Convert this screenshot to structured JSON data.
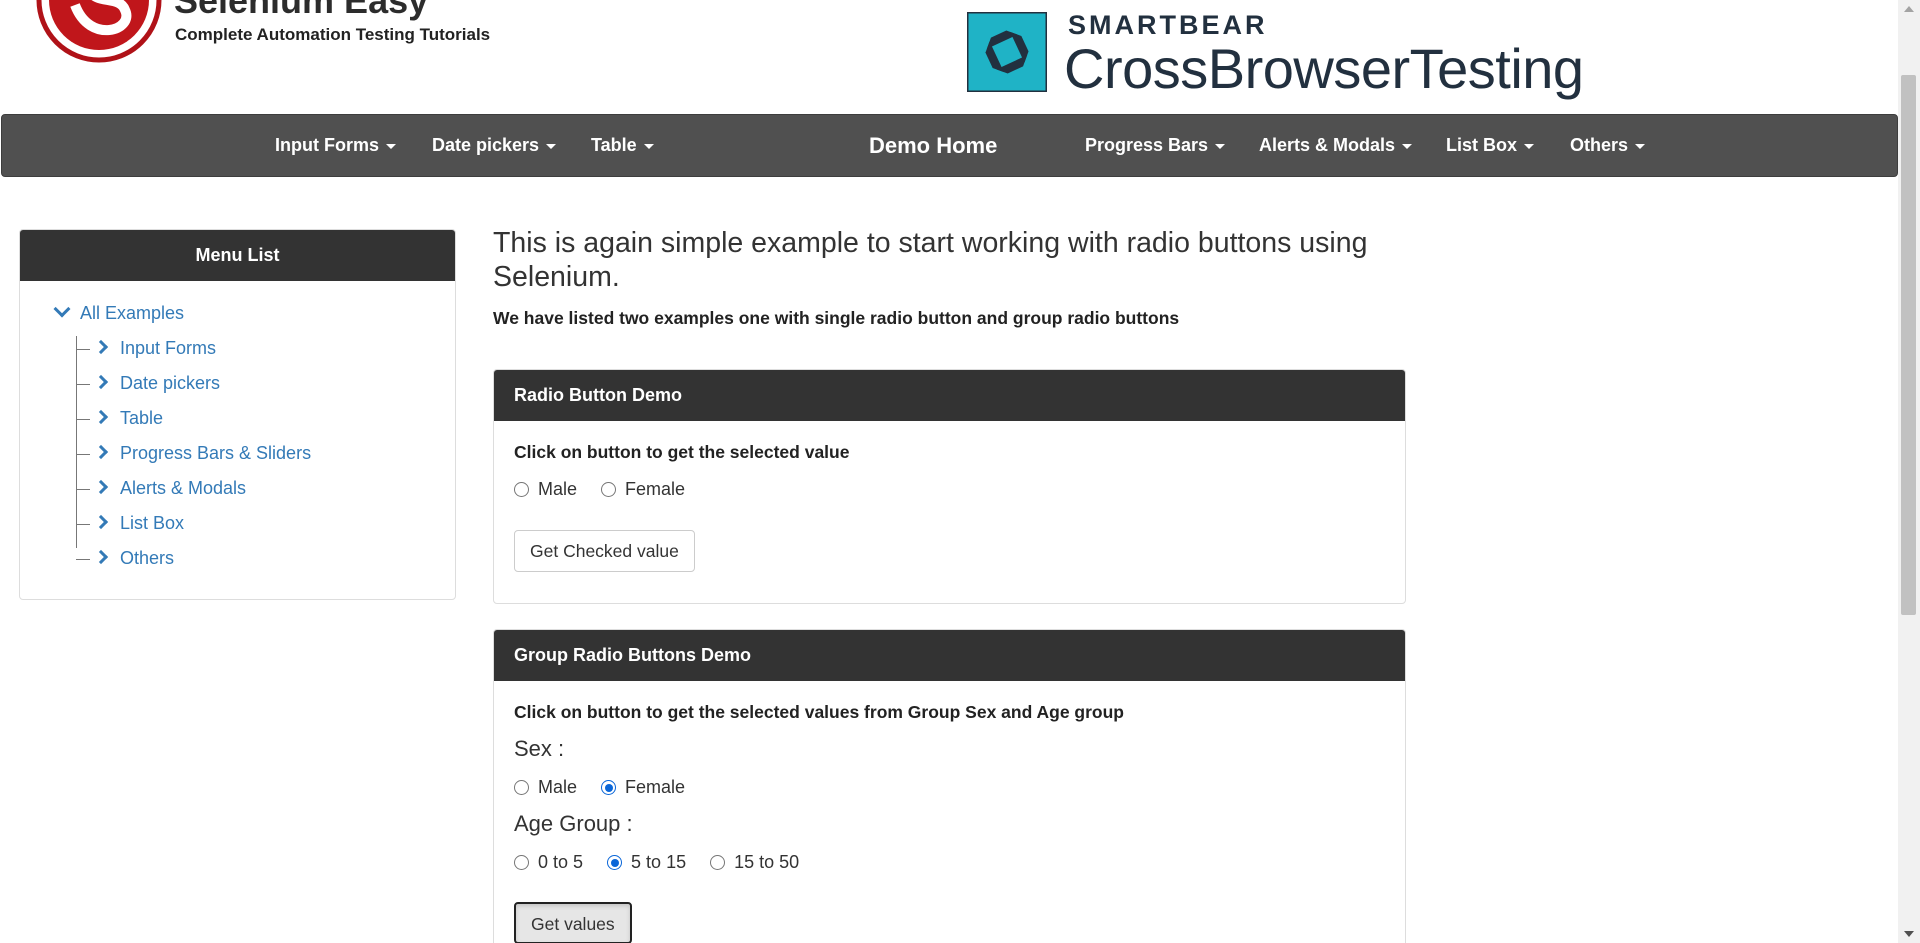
{
  "header": {
    "brand_title": "Selenium Easy",
    "brand_tagline": "Complete Automation Testing Tutorials",
    "sponsor_small": "SMARTBEAR",
    "sponsor_big": "CrossBrowserTesting"
  },
  "navbar": {
    "input_forms": "Input Forms",
    "date_pickers": "Date pickers",
    "table": "Table",
    "demo_home": "Demo Home",
    "progress_bars": "Progress Bars",
    "alerts_modals": "Alerts & Modals",
    "list_box": "List Box",
    "others": "Others"
  },
  "sidebar": {
    "heading": "Menu List",
    "root": "All Examples",
    "items": [
      "Input Forms",
      "Date pickers",
      "Table",
      "Progress Bars & Sliders",
      "Alerts & Modals",
      "List Box",
      "Others"
    ]
  },
  "main": {
    "title": "This is again simple example to start working with radio buttons using Selenium.",
    "subtitle": "We have listed two examples one with single radio button and group radio buttons"
  },
  "radio_demo": {
    "heading": "Radio Button Demo",
    "instruction": "Click on button to get the selected value",
    "options": [
      {
        "label": "Male",
        "checked": false
      },
      {
        "label": "Female",
        "checked": false
      }
    ],
    "button": "Get Checked value"
  },
  "group_demo": {
    "heading": "Group Radio Buttons Demo",
    "instruction": "Click on button to get the selected values from Group Sex and Age group",
    "sex_label": "Sex :",
    "sex_options": [
      {
        "label": "Male",
        "checked": false
      },
      {
        "label": "Female",
        "checked": true
      }
    ],
    "age_label": "Age Group :",
    "age_options": [
      {
        "label": "0 to 5",
        "checked": false
      },
      {
        "label": "5 to 15",
        "checked": true
      },
      {
        "label": "15 to 50",
        "checked": false
      }
    ],
    "button": "Get values"
  },
  "colors": {
    "navbar": "#505050",
    "panel_heading": "#333333",
    "link": "#337ab7",
    "radio_checked": "#0a66d8",
    "logo_red": "#c0161b",
    "sponsor_teal": "#1fb3c6"
  }
}
